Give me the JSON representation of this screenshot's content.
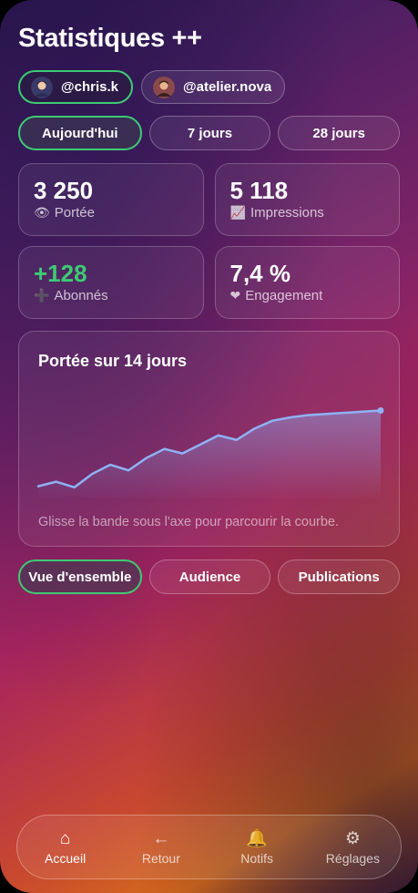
{
  "header": {
    "title": "Statistiques ++"
  },
  "accounts": [
    {
      "handle": "@chris.k",
      "active": true
    },
    {
      "handle": "@atelier.nova",
      "active": false
    }
  ],
  "ranges": [
    {
      "label": "Aujourd'hui",
      "active": true
    },
    {
      "label": "7 jours",
      "active": false
    },
    {
      "label": "28 jours",
      "active": false
    }
  ],
  "stats": [
    {
      "value": "3 250",
      "icon": "👁",
      "label": "Portée"
    },
    {
      "value": "5 118",
      "icon": "📈",
      "label": "Impressions"
    },
    {
      "value": "+128",
      "icon": "➕",
      "label": "Abonnés",
      "color": "#3ecb74"
    },
    {
      "value": "7,4 %",
      "icon": "❤",
      "label": "Engagement"
    }
  ],
  "chart": {
    "title": "Portée sur 14 jours",
    "hint": "Glisse la bande sous l'axe pour parcourir la courbe.",
    "line_color": "#8fb2f5"
  },
  "chart_data": {
    "type": "area",
    "x": [
      1,
      2,
      3,
      4,
      5,
      6,
      7,
      8,
      9,
      10,
      11,
      12,
      13,
      14,
      15,
      16,
      17,
      18,
      19,
      20
    ],
    "values": [
      10,
      14,
      9,
      21,
      29,
      24,
      35,
      43,
      39,
      47,
      55,
      51,
      61,
      68,
      71,
      73,
      74,
      75,
      76,
      77
    ],
    "ylim": [
      0,
      100
    ]
  },
  "tabs": [
    {
      "label": "Vue d'ensemble",
      "active": true
    },
    {
      "label": "Audience",
      "active": false
    },
    {
      "label": "Publications",
      "active": false
    }
  ],
  "nav": [
    {
      "icon": "⌂",
      "label": "Accueil",
      "active": true
    },
    {
      "icon": "←",
      "label": "Retour",
      "active": false
    },
    {
      "icon": "🔔",
      "label": "Notifs",
      "active": false
    },
    {
      "icon": "⚙",
      "label": "Réglages",
      "active": false
    }
  ]
}
